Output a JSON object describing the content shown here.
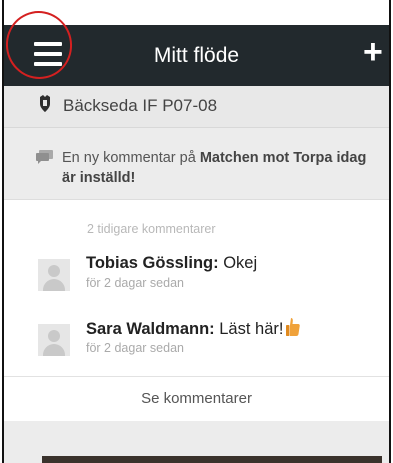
{
  "header": {
    "title": "Mitt flöde",
    "menu_icon": "hamburger-menu-icon",
    "add_icon": "plus-icon",
    "add_symbol": "+"
  },
  "team": {
    "icon": "team-shield-icon",
    "name": "Bäckseda IF P07-08"
  },
  "notice": {
    "icon": "comment-bubble-icon",
    "prefix": "En ny kommentar på ",
    "subject": "Matchen mot Torpa idag är inställd!"
  },
  "comments": {
    "earlier_label": "2 tidigare kommentarer",
    "items": [
      {
        "author": "Tobias Gössling:",
        "text": " Okej",
        "time": "för 2 dagar sedan",
        "emoji": ""
      },
      {
        "author": "Sara Waldmann:",
        "text": " Läst här!",
        "time": "för 2 dagar sedan",
        "emoji": "thumbs-up-icon"
      }
    ],
    "see_all_label": "Se kommentarer"
  },
  "colors": {
    "header_bg": "#22292d",
    "annotation_circle": "#d42020"
  }
}
